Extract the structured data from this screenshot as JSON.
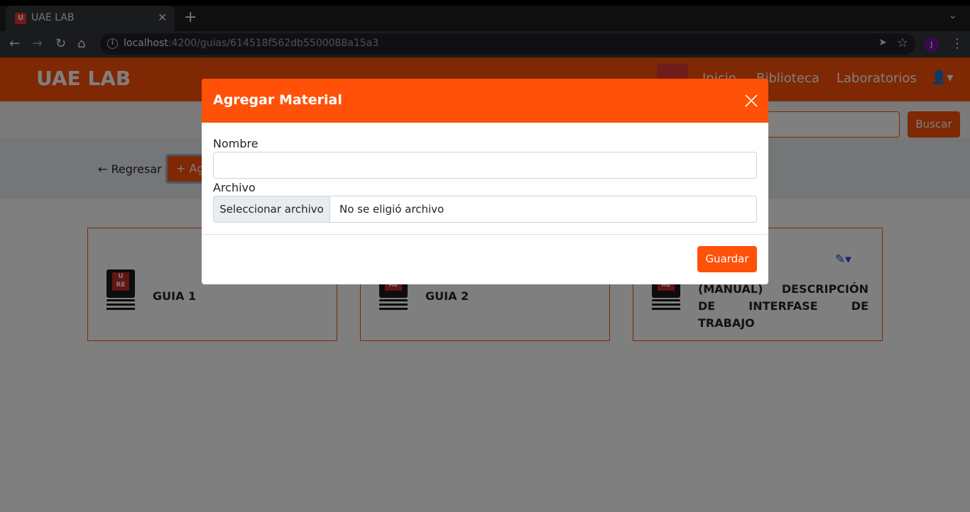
{
  "browser": {
    "tab_title": "UAE LAB",
    "url_host": "localhost",
    "url_path": ":4200/guias/614518f562db5500088a15a3",
    "profile_initial": "J"
  },
  "navbar": {
    "brand": "UAE LAB",
    "links": [
      "Inicio",
      "Biblioteca",
      "Laboratorios"
    ]
  },
  "search": {
    "button_label": "Buscar"
  },
  "actions": {
    "back_label": "Regresar",
    "add_label": "Ag"
  },
  "cards": [
    {
      "title": "GUIA 1"
    },
    {
      "title": "GUIA 2"
    },
    {
      "title": "(MANUAL) DESCRIPCIÓN DE INTERFASE DE TRABAJO"
    }
  ],
  "modal": {
    "title": "Agregar Material",
    "name_label": "Nombre",
    "file_label": "Archivo",
    "file_button": "Seleccionar archivo",
    "file_status": "No se eligió archivo",
    "save_label": "Guardar"
  },
  "colors": {
    "brand_orange": "#ff5108",
    "edit_blue": "#1f4fc4"
  }
}
